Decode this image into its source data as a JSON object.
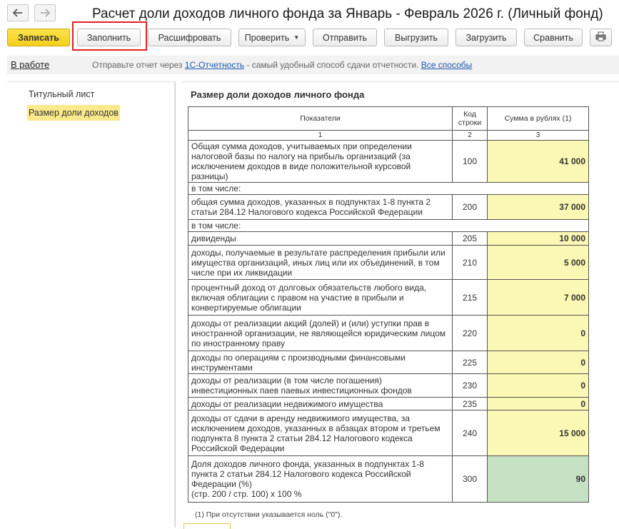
{
  "window": {
    "title": "Расчет доли доходов личного фонда за Январь - Февраль 2026 г. (Личный фонд)",
    "back_icon": "arrow-left-icon",
    "forward_icon": "arrow-right-icon"
  },
  "toolbar": {
    "save": "Записать",
    "fill": "Заполнить",
    "decode": "Расшифровать",
    "check": "Проверить",
    "send": "Отправить",
    "export": "Выгрузить",
    "import": "Загрузить",
    "compare": "Сравнить",
    "print_icon": "printer-icon"
  },
  "status": {
    "state": "В работе",
    "msg_prefix": "Отправьте отчет через ",
    "msg_link": "1С-Отчетность",
    "msg_middle": " - самый удобный способ сдачи отчетности. ",
    "msg_link2": "Все способы"
  },
  "sidebar": {
    "items": [
      {
        "label": "Титульный лист"
      },
      {
        "label": "Размер доли доходов"
      }
    ]
  },
  "report": {
    "section_title": "Размер доли доходов личного фонда",
    "headers": {
      "indicator": "Показатели",
      "code": "Код строки",
      "amount": "Сумма в рублях (1)",
      "num1": "1",
      "num2": "2",
      "num3": "3"
    },
    "rows": {
      "r100": {
        "text": "Общая сумма доходов, учитываемых при определении налоговой базы по налогу на прибыль организаций (за исключением доходов в виде положительной курсовой разницы)",
        "code": "100",
        "value": "41 000"
      },
      "incl1": "в том числе:",
      "r200": {
        "text": "общая сумма доходов, указанных в подпунктах 1-8 пункта 2 статьи 284.12 Налогового кодекса Российской Федерации",
        "code": "200",
        "value": "37 000"
      },
      "incl2": "в том числе:",
      "r205": {
        "text": "дивиденды",
        "code": "205",
        "value": "10 000"
      },
      "r210": {
        "text": "доходы, получаемые в результате распределения прибыли или имущества организаций, иных лиц или их объединений, в том числе при их ликвидации",
        "code": "210",
        "value": "5 000"
      },
      "r215": {
        "text": "процентный доход от долговых обязательств любого вида, включая облигации с правом на участие в прибыли и конвертируемые облигации",
        "code": "215",
        "value": "7 000"
      },
      "r220": {
        "text": "доходы от реализации акций (долей) и (или) уступки прав в иностранной организации, не являющейся юридическим лицом по иностранному праву",
        "code": "220",
        "value": "0"
      },
      "r225": {
        "text": "доходы по операциям с производными финансовыми инструментами",
        "code": "225",
        "value": "0"
      },
      "r230": {
        "text": "доходы от реализации (в том числе погашения) инвестиционных паев паевых инвестиционных фондов",
        "code": "230",
        "value": "0"
      },
      "r235": {
        "text": "доходы от реализации недвижимого имущества",
        "code": "235",
        "value": "0"
      },
      "r240": {
        "text": "доходы от сдачи в аренду недвижимого имущества, за исключением доходов, указанных в абзацах втором и третьем подпункта 8 пункта 2 статьи 284.12 Налогового кодекса Российской Федерации",
        "code": "240",
        "value": "15 000"
      },
      "r300": {
        "text": "Доля доходов личного фонда, указанных в подпунктах 1-8 пункта 2 статьи 284.12 Налогового кодекса Российской Федерации (%)",
        "formula": "(стр. 200 / стр. 100) х 100 %",
        "code": "300",
        "value": "90"
      }
    },
    "footnote": "(1) При отсутствии указывается ноль (\"0\")."
  },
  "colors": {
    "primary_button": "#f3cf1c",
    "input_cell": "#fbf7b4",
    "computed_cell": "#c6e0c3",
    "highlight_frame": "#e02020",
    "link": "#1a55b0",
    "active_nav": "#fbe98c"
  }
}
